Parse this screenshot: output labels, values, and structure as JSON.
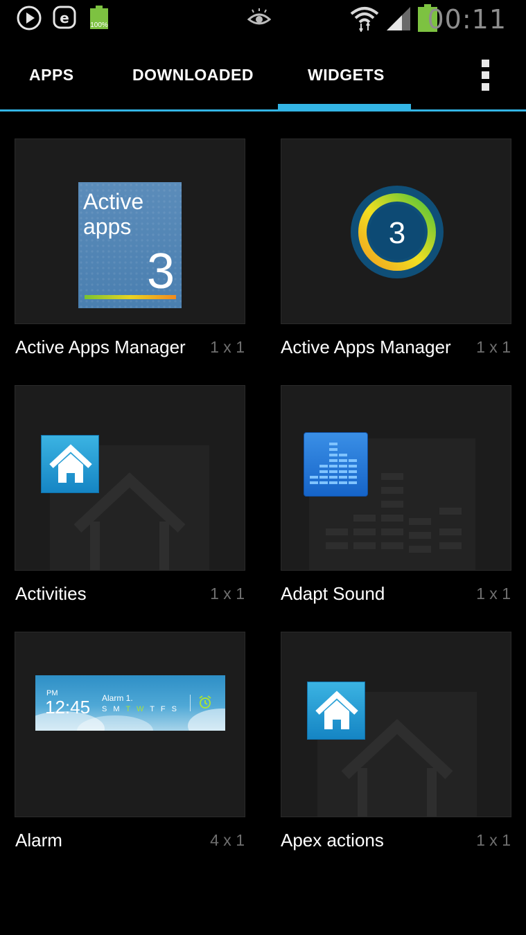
{
  "status_bar": {
    "time": "00:11",
    "battery_small_label": "100%",
    "icons": [
      "play-icon",
      "e-icon",
      "battery-small-icon",
      "eye-icon",
      "wifi-icon",
      "signal-icon",
      "battery-icon"
    ]
  },
  "tabs": [
    {
      "label": "APPS",
      "selected": false
    },
    {
      "label": "DOWNLOADED",
      "selected": false
    },
    {
      "label": "WIDGETS",
      "selected": true
    }
  ],
  "accent_color": "#33b5e5",
  "widgets": [
    {
      "name": "Active Apps Manager",
      "size": "1 x 1",
      "preview": "active-apps-tile",
      "preview_text": {
        "line1": "Active",
        "line2": "apps",
        "count": "3"
      }
    },
    {
      "name": "Active Apps Manager",
      "size": "1 x 1",
      "preview": "active-apps-ring",
      "preview_text": {
        "count": "3"
      }
    },
    {
      "name": "Activities",
      "size": "1 x 1",
      "preview": "home-icon"
    },
    {
      "name": "Adapt Sound",
      "size": "1 x 1",
      "preview": "equalizer-icon"
    },
    {
      "name": "Alarm",
      "size": "4 x 1",
      "preview": "alarm-widget",
      "preview_text": {
        "ampm": "PM",
        "time": "12:45",
        "title": "Alarm 1.",
        "days": [
          "S",
          "M",
          "T",
          "W",
          "T",
          "F",
          "S"
        ]
      }
    },
    {
      "name": "Apex actions",
      "size": "1 x 1",
      "preview": "home-icon"
    }
  ]
}
